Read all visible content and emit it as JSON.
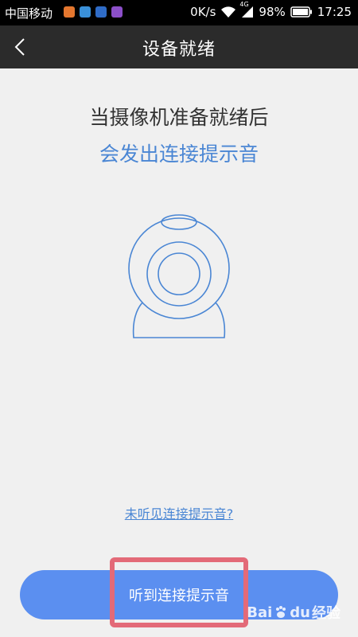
{
  "status_bar": {
    "carrier": "中国移动",
    "speed": "0K/s",
    "network": "4G",
    "battery": "98%",
    "time": "17:25",
    "app_icons": [
      {
        "name": "app-icon-orange",
        "color": "#e4772f"
      },
      {
        "name": "app-icon-blue",
        "color": "#3a90d8"
      },
      {
        "name": "app-icon-chat",
        "color": "#2f6cc7"
      },
      {
        "name": "app-icon-purple",
        "color": "#8c4fc9"
      }
    ]
  },
  "header": {
    "title": "设备就绪",
    "back_icon": "chevron-left-icon"
  },
  "main": {
    "headline": "当摄像机准备就绪后",
    "subline": "会发出连接提示音",
    "illustration_icon": "webcam-icon",
    "help_link": "未听见连接提示音?",
    "primary_button": "听到连接提示音"
  },
  "watermark": {
    "text_bai": "Bai",
    "text_du": "du",
    "text_jingyan": "经验"
  },
  "colors": {
    "accent": "#4a86d4",
    "button": "#5b8ff0",
    "highlight": "#e36a78",
    "title_bar": "#2b2b2b"
  }
}
